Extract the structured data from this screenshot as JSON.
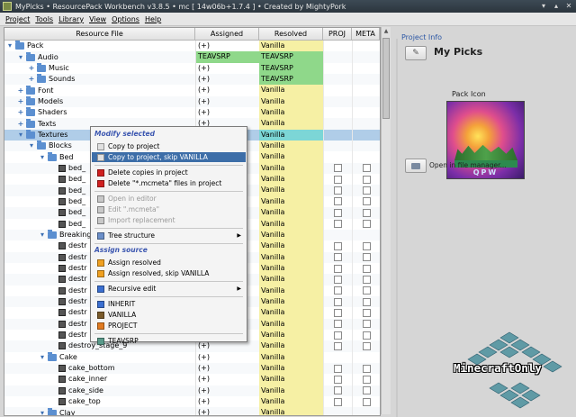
{
  "window": {
    "title": "MyPicks  •  ResourcePack Workbench v3.8.5  •  mc [ 14w06b+1.7.4 ]  •  Created by MightyPork"
  },
  "menubar": [
    "Project",
    "Tools",
    "Library",
    "View",
    "Options",
    "Help"
  ],
  "table": {
    "headers": [
      "Resource File",
      "Assigned",
      "Resolved",
      "PROJ",
      "META"
    ],
    "rows": [
      {
        "name": "Pack",
        "level": 0,
        "kind": "folder",
        "assigned": "(+)",
        "resolved": "Vanilla",
        "rstyle": "",
        "astyle": "",
        "checks": false,
        "exp": "−"
      },
      {
        "name": "Audio",
        "level": 1,
        "kind": "folder",
        "assigned": "TEAVSRP",
        "resolved": "TEAVSRP",
        "rstyle": "teav",
        "astyle": "teav",
        "checks": false,
        "exp": "−"
      },
      {
        "name": "Music",
        "level": 2,
        "kind": "folder",
        "assigned": "(+)",
        "resolved": "TEAVSRP",
        "rstyle": "teav",
        "astyle": "",
        "checks": false,
        "exp": "+"
      },
      {
        "name": "Sounds",
        "level": 2,
        "kind": "folder",
        "assigned": "(+)",
        "resolved": "TEAVSRP",
        "rstyle": "teav",
        "astyle": "",
        "checks": false,
        "exp": "+"
      },
      {
        "name": "Font",
        "level": 1,
        "kind": "folder",
        "assigned": "(+)",
        "resolved": "Vanilla",
        "rstyle": "",
        "astyle": "",
        "checks": false,
        "exp": "+"
      },
      {
        "name": "Models",
        "level": 1,
        "kind": "folder",
        "assigned": "(+)",
        "resolved": "Vanilla",
        "rstyle": "",
        "astyle": "",
        "checks": false,
        "exp": "+"
      },
      {
        "name": "Shaders",
        "level": 1,
        "kind": "folder",
        "assigned": "(+)",
        "resolved": "Vanilla",
        "rstyle": "",
        "astyle": "",
        "checks": false,
        "exp": "+"
      },
      {
        "name": "Texts",
        "level": 1,
        "kind": "folder",
        "assigned": "(+)",
        "resolved": "Vanilla",
        "rstyle": "",
        "astyle": "",
        "checks": false,
        "exp": "+"
      },
      {
        "name": "Textures",
        "level": 1,
        "kind": "folder",
        "assigned": "",
        "resolved": "Vanilla",
        "rstyle": "sel",
        "astyle": "",
        "checks": false,
        "exp": "−",
        "selected": true
      },
      {
        "name": "Blocks",
        "level": 2,
        "kind": "folder",
        "assigned": "",
        "resolved": "Vanilla",
        "rstyle": "",
        "astyle": "",
        "checks": false,
        "exp": "−"
      },
      {
        "name": "Bed",
        "level": 3,
        "kind": "folder",
        "assigned": "",
        "resolved": "Vanilla",
        "rstyle": "",
        "astyle": "",
        "checks": false,
        "exp": "−"
      },
      {
        "name": "bed_",
        "level": 4,
        "kind": "file",
        "assigned": "",
        "resolved": "Vanilla",
        "rstyle": "",
        "astyle": "",
        "checks": true,
        "exp": ""
      },
      {
        "name": "bed_",
        "level": 4,
        "kind": "file",
        "assigned": "",
        "resolved": "Vanilla",
        "rstyle": "",
        "astyle": "",
        "checks": true,
        "exp": ""
      },
      {
        "name": "bed_",
        "level": 4,
        "kind": "file",
        "assigned": "",
        "resolved": "Vanilla",
        "rstyle": "",
        "astyle": "",
        "checks": true,
        "exp": ""
      },
      {
        "name": "bed_",
        "level": 4,
        "kind": "file",
        "assigned": "",
        "resolved": "Vanilla",
        "rstyle": "",
        "astyle": "",
        "checks": true,
        "exp": ""
      },
      {
        "name": "bed_",
        "level": 4,
        "kind": "file",
        "assigned": "",
        "resolved": "Vanilla",
        "rstyle": "",
        "astyle": "",
        "checks": true,
        "exp": ""
      },
      {
        "name": "bed_",
        "level": 4,
        "kind": "file",
        "assigned": "",
        "resolved": "Vanilla",
        "rstyle": "",
        "astyle": "",
        "checks": true,
        "exp": ""
      },
      {
        "name": "Breaking",
        "level": 3,
        "kind": "folder",
        "assigned": "",
        "resolved": "Vanilla",
        "rstyle": "",
        "astyle": "",
        "checks": false,
        "exp": "−"
      },
      {
        "name": "destr",
        "level": 4,
        "kind": "file",
        "assigned": "",
        "resolved": "Vanilla",
        "rstyle": "",
        "astyle": "",
        "checks": true,
        "exp": ""
      },
      {
        "name": "destr",
        "level": 4,
        "kind": "file",
        "assigned": "",
        "resolved": "Vanilla",
        "rstyle": "",
        "astyle": "",
        "checks": true,
        "exp": ""
      },
      {
        "name": "destr",
        "level": 4,
        "kind": "file",
        "assigned": "",
        "resolved": "Vanilla",
        "rstyle": "",
        "astyle": "",
        "checks": true,
        "exp": ""
      },
      {
        "name": "destr",
        "level": 4,
        "kind": "file",
        "assigned": "",
        "resolved": "Vanilla",
        "rstyle": "",
        "astyle": "",
        "checks": true,
        "exp": ""
      },
      {
        "name": "destr",
        "level": 4,
        "kind": "file",
        "assigned": "",
        "resolved": "Vanilla",
        "rstyle": "",
        "astyle": "",
        "checks": true,
        "exp": ""
      },
      {
        "name": "destr",
        "level": 4,
        "kind": "file",
        "assigned": "",
        "resolved": "Vanilla",
        "rstyle": "",
        "astyle": "",
        "checks": true,
        "exp": ""
      },
      {
        "name": "destr",
        "level": 4,
        "kind": "file",
        "assigned": "",
        "resolved": "Vanilla",
        "rstyle": "",
        "astyle": "",
        "checks": true,
        "exp": ""
      },
      {
        "name": "destr",
        "level": 4,
        "kind": "file",
        "assigned": "",
        "resolved": "Vanilla",
        "rstyle": "",
        "astyle": "",
        "checks": true,
        "exp": ""
      },
      {
        "name": "destr",
        "level": 4,
        "kind": "file",
        "assigned": "",
        "resolved": "Vanilla",
        "rstyle": "",
        "astyle": "",
        "checks": true,
        "exp": ""
      },
      {
        "name": "destroy_stage_9",
        "level": 4,
        "kind": "file",
        "assigned": "(+)",
        "resolved": "Vanilla",
        "rstyle": "",
        "astyle": "",
        "checks": true,
        "exp": ""
      },
      {
        "name": "Cake",
        "level": 3,
        "kind": "folder",
        "assigned": "(+)",
        "resolved": "Vanilla",
        "rstyle": "",
        "astyle": "",
        "checks": false,
        "exp": "−"
      },
      {
        "name": "cake_bottom",
        "level": 4,
        "kind": "file",
        "assigned": "(+)",
        "resolved": "Vanilla",
        "rstyle": "",
        "astyle": "",
        "checks": true,
        "exp": ""
      },
      {
        "name": "cake_inner",
        "level": 4,
        "kind": "file",
        "assigned": "(+)",
        "resolved": "Vanilla",
        "rstyle": "",
        "astyle": "",
        "checks": true,
        "exp": ""
      },
      {
        "name": "cake_side",
        "level": 4,
        "kind": "file",
        "assigned": "(+)",
        "resolved": "Vanilla",
        "rstyle": "",
        "astyle": "",
        "checks": true,
        "exp": ""
      },
      {
        "name": "cake_top",
        "level": 4,
        "kind": "file",
        "assigned": "(+)",
        "resolved": "Vanilla",
        "rstyle": "",
        "astyle": "",
        "checks": true,
        "exp": ""
      },
      {
        "name": "Clay",
        "level": 3,
        "kind": "folder",
        "assigned": "(+)",
        "resolved": "Vanilla",
        "rstyle": "",
        "astyle": "",
        "checks": false,
        "exp": "−"
      }
    ]
  },
  "context_menu": {
    "items": [
      {
        "type": "head",
        "label": "Modify selected"
      },
      {
        "type": "item",
        "label": "Copy to project",
        "icon": "copy-icon",
        "color": "#e0e0e0"
      },
      {
        "type": "item",
        "label": "Copy to project, skip VANILLA",
        "icon": "copy-skip-icon",
        "color": "#e0e0e0",
        "hl": true
      },
      {
        "type": "sep"
      },
      {
        "type": "item",
        "label": "Delete copies in project",
        "icon": "delete-icon",
        "color": "#d02020"
      },
      {
        "type": "item",
        "label": "Delete \"*.mcmeta\" files in project",
        "icon": "delete-meta-icon",
        "color": "#d02020"
      },
      {
        "type": "sep"
      },
      {
        "type": "item",
        "label": "Open in editor",
        "icon": "editor-icon",
        "color": "#c8c8c8",
        "dis": true
      },
      {
        "type": "item",
        "label": "Edit \".mcmeta\"",
        "icon": "edit-meta-icon",
        "color": "#c8c8c8",
        "dis": true
      },
      {
        "type": "item",
        "label": "Import replacement",
        "icon": "import-icon",
        "color": "#c8c8c8",
        "dis": true
      },
      {
        "type": "sep"
      },
      {
        "type": "item",
        "label": "Tree structure",
        "icon": "tree-icon",
        "color": "#6b8fc9",
        "sub": true
      },
      {
        "type": "sep"
      },
      {
        "type": "head",
        "label": "Assign source"
      },
      {
        "type": "item",
        "label": "Assign resolved",
        "icon": "assign-icon",
        "color": "#f0a020"
      },
      {
        "type": "item",
        "label": "Assign resolved, skip VANILLA",
        "icon": "assign-skip-icon",
        "color": "#f0a020"
      },
      {
        "type": "sep"
      },
      {
        "type": "item",
        "label": "Recursive edit",
        "icon": "recursive-icon",
        "color": "#3b6fd0",
        "sub": true
      },
      {
        "type": "sep"
      },
      {
        "type": "item",
        "label": "INHERIT",
        "icon": "inherit-icon",
        "color": "#3b6fd0"
      },
      {
        "type": "item",
        "label": "VANILLA",
        "icon": "vanilla-icon",
        "color": "#7a5a2a"
      },
      {
        "type": "item",
        "label": "PROJECT",
        "icon": "project-icon",
        "color": "#e07a20"
      },
      {
        "type": "sep"
      },
      {
        "type": "item",
        "label": "TEAVSRP",
        "icon": "teavsrp-icon",
        "color": "#5a9a8a"
      }
    ]
  },
  "project_info": {
    "section_label": "Project Info",
    "pack_name": "My Picks",
    "pack_icon_label": "Pack Icon",
    "pack_icon_text": "QPW",
    "open_label": "Open in file manager..."
  },
  "watermark": {
    "text": "MinecraftOnly"
  },
  "colors": {
    "accent": "#3d6ea8",
    "resolved_vanilla": "#f6f0a4",
    "resolved_teavsrp": "#8fd88a",
    "selected_row": "#7cd6d6"
  }
}
